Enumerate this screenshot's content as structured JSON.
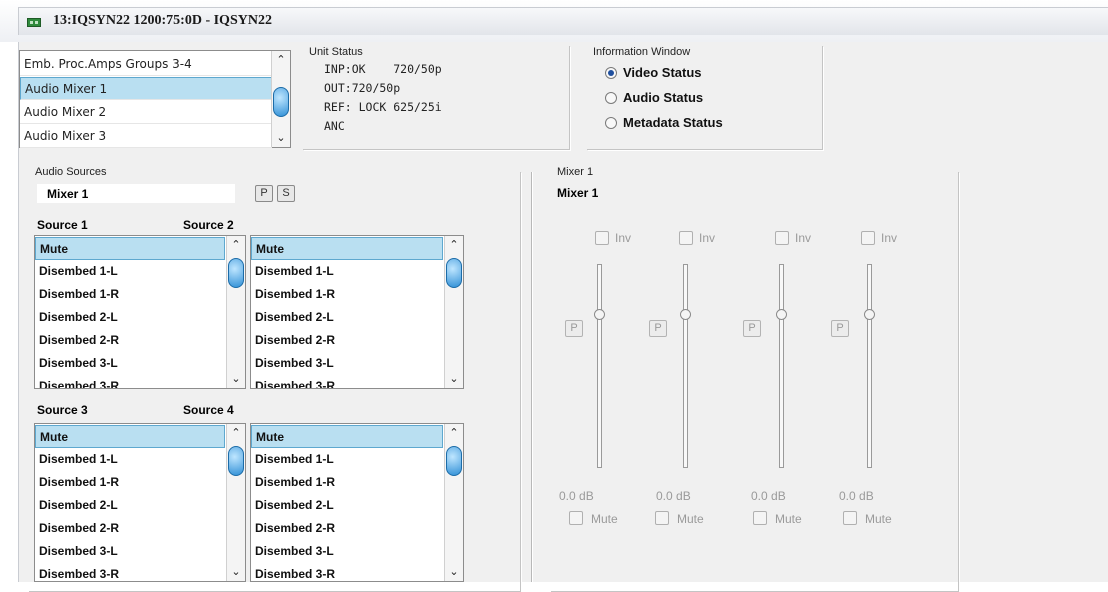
{
  "window": {
    "title": "13:IQSYN22  1200:75:0D  - IQSYN22"
  },
  "unit_list": {
    "items": [
      "Emb. Proc.Amps Groups 3-4",
      "Audio Mixer 1",
      "Audio Mixer 2",
      "Audio Mixer 3"
    ],
    "selected": "Audio Mixer 1"
  },
  "unit_status": {
    "label": "Unit Status",
    "lines": [
      "INP:OK    720/50p",
      "OUT:720/50p",
      "REF: LOCK 625/25i",
      "ANC"
    ]
  },
  "info_window": {
    "label": "Information Window",
    "options": [
      "Video Status",
      "Audio Status",
      "Metadata Status"
    ],
    "selected": "Video Status"
  },
  "audio_sources": {
    "label": "Audio Sources",
    "mixer_name": "Mixer 1",
    "p_label": "P",
    "s_label": "S",
    "source_headers": [
      "Source 1",
      "Source 2",
      "Source 3",
      "Source 4"
    ],
    "list_items": [
      "Mute",
      "Disembed 1-L",
      "Disembed 1-R",
      "Disembed 2-L",
      "Disembed 2-R",
      "Disembed 3-L",
      "Disembed 3-R"
    ],
    "selected": "Mute"
  },
  "mixer": {
    "label": "Mixer 1",
    "title": "Mixer 1",
    "inv_label": "Inv",
    "p_label": "P",
    "mute_label": "Mute",
    "channels": [
      {
        "gain": "0.0 dB",
        "level": 0.75
      },
      {
        "gain": "0.0 dB",
        "level": 0.75
      },
      {
        "gain": "0.0 dB",
        "level": 0.75
      },
      {
        "gain": "0.0 dB",
        "level": 0.75
      }
    ]
  }
}
